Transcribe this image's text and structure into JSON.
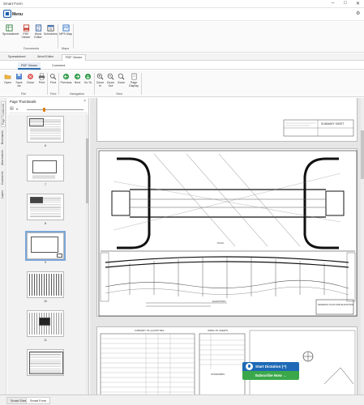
{
  "window": {
    "title": "Smart Form",
    "min": "–",
    "max": "□",
    "close": "✕"
  },
  "app": {
    "menu_label": "Menu"
  },
  "ribbon1": {
    "buttons": [
      {
        "label": "Spreadsheet",
        "icon": "spreadsheet-icon"
      },
      {
        "label": "PDF Viewer",
        "icon": "pdf-viewer-icon"
      },
      {
        "label": "Word Editor",
        "icon": "word-editor-icon"
      },
      {
        "label": "Schedules",
        "icon": "schedules-icon"
      },
      {
        "label": "MPS Map",
        "icon": "map-icon"
      }
    ],
    "groups": [
      "Documents",
      "Maps"
    ]
  },
  "doc_tabs": [
    "Spreadsheet",
    "Word Editor",
    "PDF Viewer"
  ],
  "sub_tabs": [
    "PDF Viewer",
    "Comment"
  ],
  "ribbon2": {
    "buttons": [
      {
        "label": "Open",
        "icon": "open-folder-icon"
      },
      {
        "label": "Save As",
        "icon": "save-icon"
      },
      {
        "label": "Close",
        "icon": "close-file-icon"
      },
      {
        "label": "Print",
        "icon": "print-icon"
      },
      {
        "label": "Find",
        "icon": "find-icon"
      },
      {
        "label": "Previous",
        "icon": "previous-icon"
      },
      {
        "label": "Next",
        "icon": "next-icon"
      },
      {
        "label": "Go To",
        "icon": "goto-icon"
      },
      {
        "label": "Zoom In",
        "icon": "zoom-in-icon"
      },
      {
        "label": "Zoom Out",
        "icon": "zoom-out-icon"
      },
      {
        "label": "Zoom",
        "icon": "zoom-icon"
      },
      {
        "label": "Page Display",
        "icon": "page-display-icon"
      }
    ],
    "groups": [
      "File",
      "Find",
      "Navigation",
      "View"
    ]
  },
  "side_tabs": [
    "Page Thumbnails",
    "Bookmarks",
    "Attachments",
    "Comments",
    "Layers"
  ],
  "thumbnails": {
    "header": "Page Thumbnails",
    "pages": [
      "6",
      "7",
      "8",
      "9",
      "10",
      "11"
    ]
  },
  "drawing": {
    "sheet_title": "SUMMARY SHEET",
    "elevation_title": "GENERAL PLAN AND ELEVATION",
    "plan_label": "PLAN",
    "elevation_label": "ELEVATION",
    "index_title": "INDEX OF SHEETS",
    "quantities_title": "SUMMARY OF QUANTITIES",
    "standards_title": "STANDARDS"
  },
  "dictation": {
    "start_label": "Start Dictation (^)",
    "subscribe_label": "Subscribe Now →"
  },
  "bottom_tabs": [
    "Smart Sheet",
    "Smart Form"
  ],
  "colors": {
    "accent": "#2b6cb0",
    "dictation_blue": "#1e6ab6",
    "subscribe_green": "#3aa84a"
  }
}
